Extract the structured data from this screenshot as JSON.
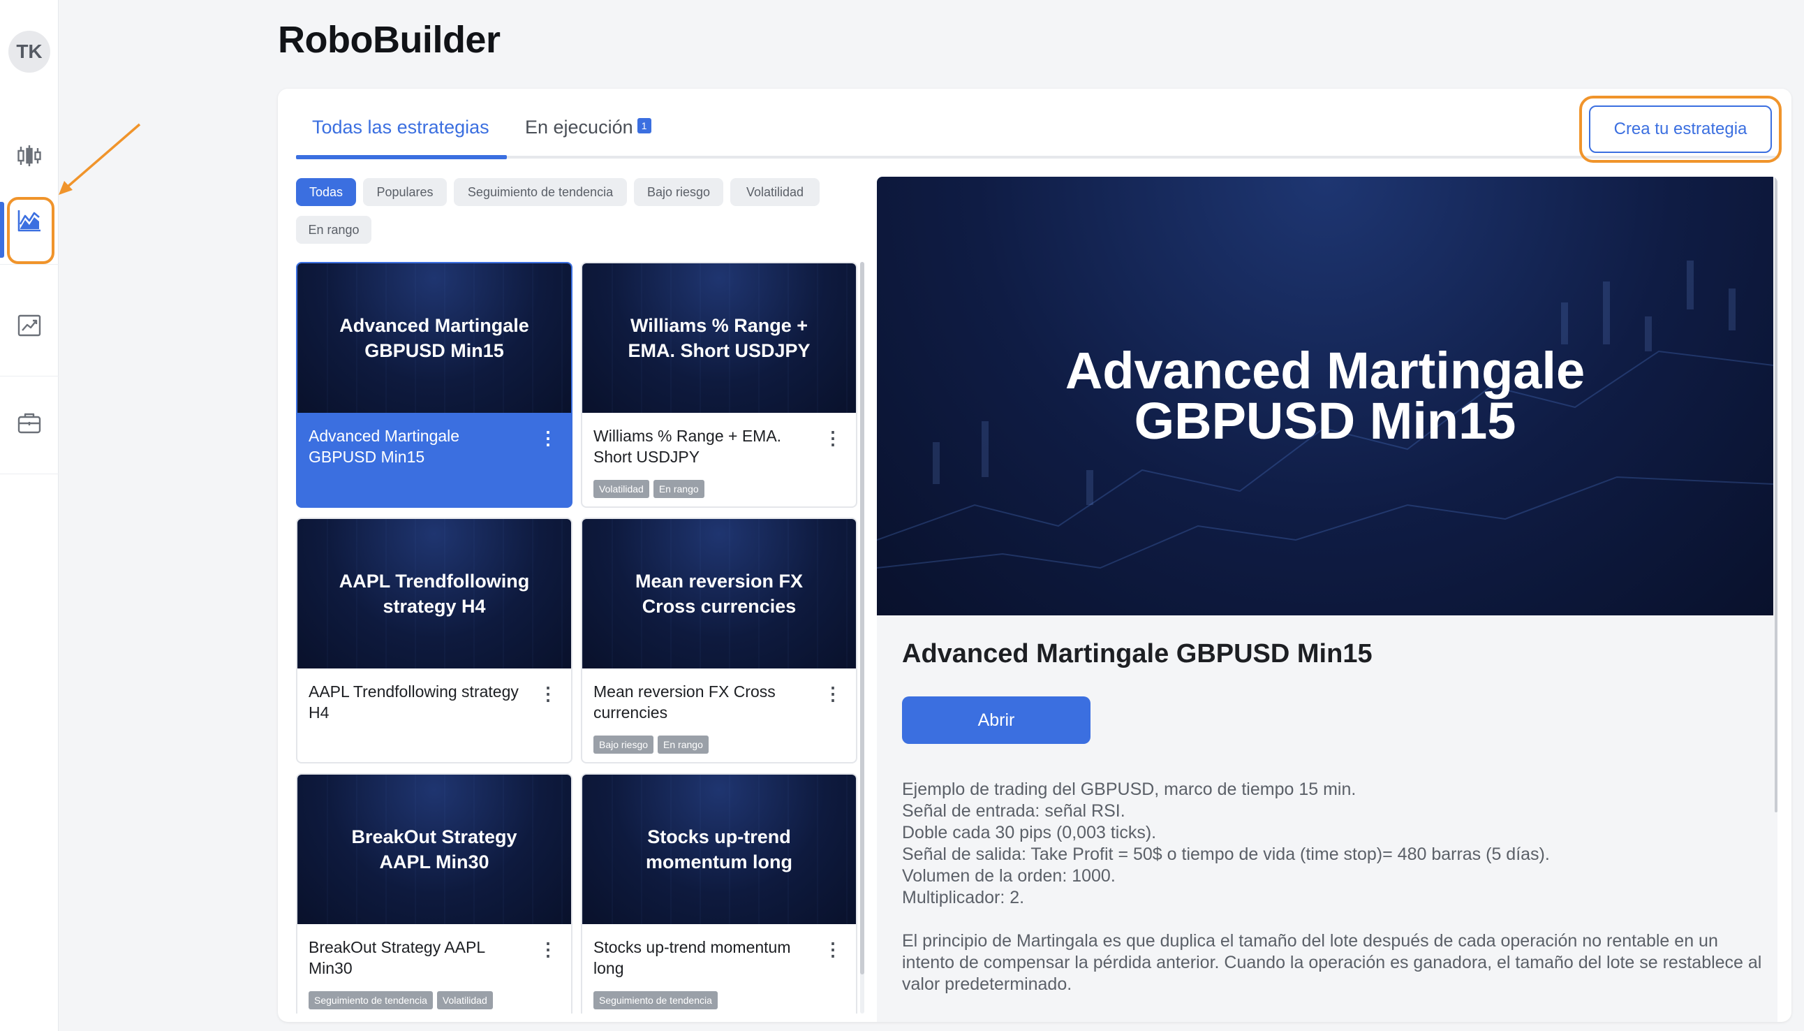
{
  "app": {
    "title": "RoboBuilder",
    "avatar_initials": "TK"
  },
  "sidebar": {
    "items": [
      {
        "name": "indicators",
        "icon": "candlestick-icon",
        "active": false
      },
      {
        "name": "robobuilder",
        "icon": "area-chart-icon",
        "active": true
      },
      {
        "name": "analytics",
        "icon": "trending-chart-icon",
        "active": false
      },
      {
        "name": "portfolio",
        "icon": "briefcase-icon",
        "active": false
      }
    ]
  },
  "tabs": {
    "all_label": "Todas las estrategias",
    "running_label": "En ejecución",
    "running_count": "1"
  },
  "create_button": {
    "label": "Crea tu estrategia"
  },
  "filters": [
    "Todas",
    "Populares",
    "Seguimiento de tendencia",
    "Bajo riesgo",
    "Volatilidad",
    "En rango"
  ],
  "strategies": [
    {
      "thumb_title": "Advanced Martingale GBPUSD Min15",
      "title": "Advanced Martingale GBPUSD Min15",
      "tags": [],
      "selected": true
    },
    {
      "thumb_title": "Williams % Range + EMA. Short USDJPY",
      "title": "Williams % Range + EMA. Short USDJPY",
      "tags": [
        "Volatilidad",
        "En rango"
      ]
    },
    {
      "thumb_title": "AAPL Trendfollowing strategy H4",
      "title": "AAPL Trendfollowing strategy H4",
      "tags": []
    },
    {
      "thumb_title": "Mean reversion FX Cross currencies",
      "title": "Mean reversion FX Cross currencies",
      "tags": [
        "Bajo riesgo",
        "En rango"
      ]
    },
    {
      "thumb_title": "BreakOut Strategy AAPL Min30",
      "title": "BreakOut Strategy AAPL Min30",
      "tags": [
        "Seguimiento de tendencia",
        "Volatilidad"
      ]
    },
    {
      "thumb_title": "Stocks up-trend momentum long",
      "title": "Stocks up-trend momentum long",
      "tags": [
        "Seguimiento de tendencia"
      ]
    }
  ],
  "card_menu_icon": "⋮",
  "detail": {
    "hero_title": "Advanced Martingale GBPUSD Min15",
    "title": "Advanced Martingale GBPUSD Min15",
    "open_label": "Abrir",
    "description_lines": [
      "Ejemplo de trading del GBPUSD, marco de tiempo 15 min.",
      "Señal de entrada: señal RSI.",
      "Doble cada 30 pips (0,003 ticks).",
      "Señal de salida: Take Profit = 50$ o tiempo de vida (time stop)= 480 barras (5 días).",
      "Volumen de la orden: 1000.",
      "Multiplicador: 2."
    ],
    "description_paragraph": "El principio de Martingala es que duplica el tamaño del lote después de cada operación no rentable en un intento de compensar la pérdida anterior. Cuando la operación es ganadora, el tamaño del lote se restablece al valor predeterminado."
  },
  "colors": {
    "accent": "#3b6fe0",
    "annotation": "#f0942b",
    "thumb_dark": "#0e1a3e"
  }
}
